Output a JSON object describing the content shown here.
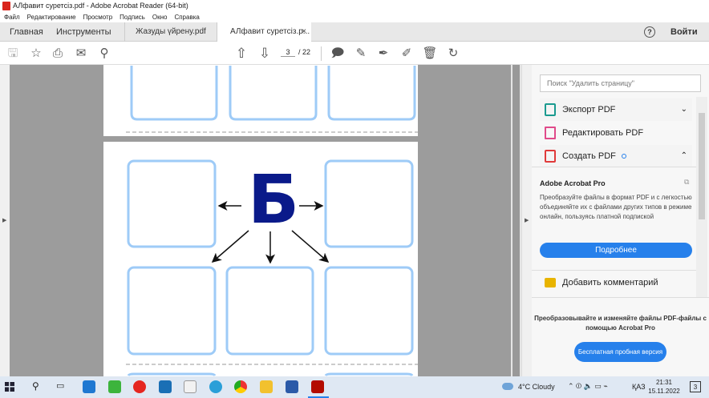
{
  "window": {
    "title": "АЛфавит суретсіз.pdf - Adobe Acrobat Reader (64-bit)"
  },
  "menu": [
    "Файл",
    "Редактирование",
    "Просмотр",
    "Подпись",
    "Окно",
    "Справка"
  ],
  "tabs": {
    "home": "Главная",
    "tools": "Инструменты",
    "doc1": "Жазуды үйрену.pdf",
    "doc2": "АЛфавит суретсіз.p...",
    "close": "×",
    "help": "?",
    "signin": "Войти"
  },
  "toolbar": {
    "page_current": "3",
    "page_sep": "/",
    "page_total": "22"
  },
  "document": {
    "letter": "Б",
    "colors": {
      "letter": "#0a1a8a",
      "box": "#9ecbf7"
    }
  },
  "panel": {
    "search_placeholder": "Поиск \"Удалить страницу\"",
    "tools": [
      {
        "label": "Экспорт PDF"
      },
      {
        "label": "Редактировать PDF"
      },
      {
        "label": "Создать PDF"
      }
    ],
    "promo_title": "Adobe Acrobat Pro",
    "promo_text": "Преобразуйте файлы в формат PDF и с легкостью объединяйте их с файлами других типов в режиме онлайн, пользуясь платной подпиской",
    "promo_button": "Подробнее",
    "comment_tool": "Добавить комментарий",
    "footer_text": "Преобразовывайте и изменяйте файлы PDF-файлы с помощью Acrobat Pro",
    "trial_button": "Бесплатная пробная версия"
  },
  "taskbar": {
    "weather": "4°C  Cloudy",
    "lang": "ҚАЗ",
    "time": "21:31",
    "date": "15.11.2022",
    "notif": "3"
  }
}
